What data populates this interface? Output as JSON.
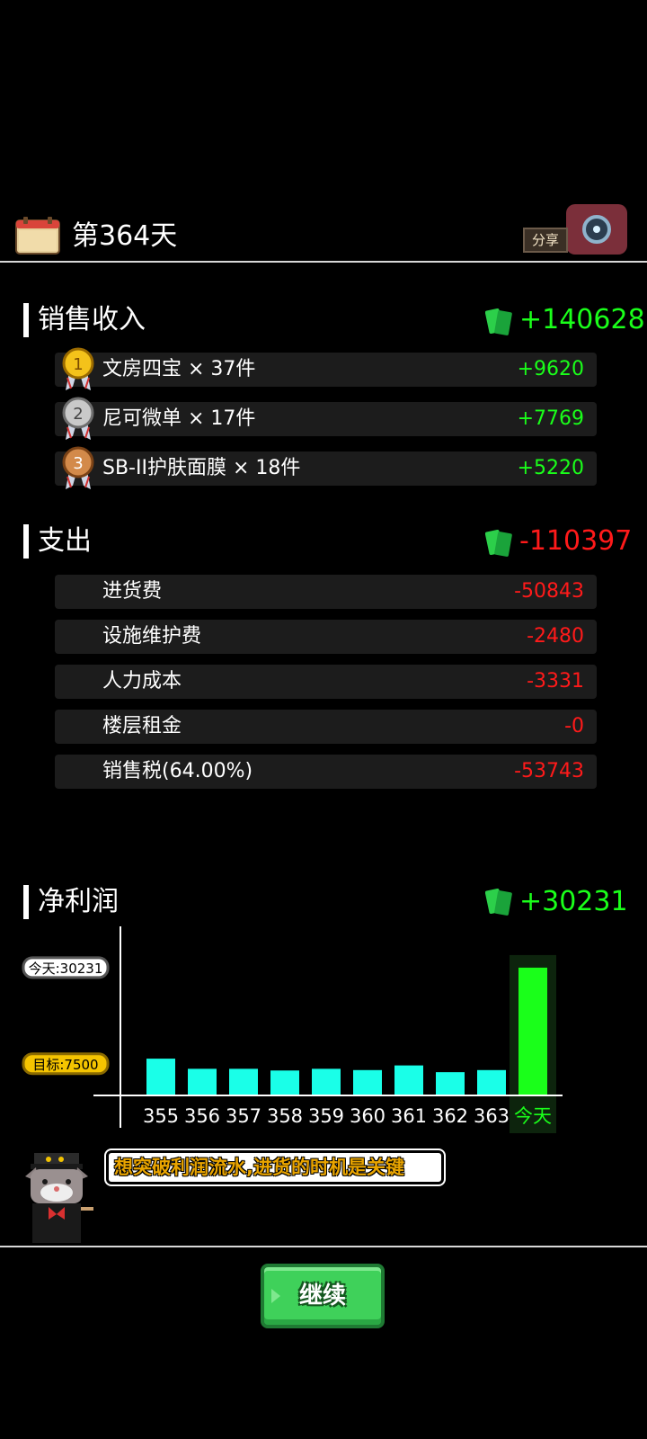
{
  "header": {
    "day_title": "第364天",
    "share_label": "分享"
  },
  "income": {
    "title": "销售收入",
    "total": "+140628",
    "items": [
      {
        "rank": "1",
        "name": "文房四宝 × 37件",
        "amount": "+9620"
      },
      {
        "rank": "2",
        "name": "尼可微单 × 17件",
        "amount": "+7769"
      },
      {
        "rank": "3",
        "name": "SB-II护肤面膜 × 18件",
        "amount": "+5220"
      }
    ]
  },
  "expense": {
    "title": "支出",
    "total": "-110397",
    "items": [
      {
        "name": "进货费",
        "amount": "-50843"
      },
      {
        "name": "设施维护费",
        "amount": "-2480"
      },
      {
        "name": "人力成本",
        "amount": "-3331"
      },
      {
        "name": "楼层租金",
        "amount": "-0"
      },
      {
        "name": "销售税(64.00%)",
        "amount": "-53743"
      }
    ]
  },
  "profit": {
    "title": "净利润",
    "total": "+30231"
  },
  "chart_data": {
    "type": "bar",
    "categories": [
      "355",
      "356",
      "357",
      "358",
      "359",
      "360",
      "361",
      "362",
      "363",
      "今天"
    ],
    "values": [
      8700,
      6300,
      6300,
      5900,
      6300,
      6000,
      7100,
      5500,
      6000,
      30231
    ],
    "today_label": "今天:30231",
    "target_label": "目标:7500",
    "target_value": 7500,
    "ylim": [
      0,
      40000
    ],
    "colors": {
      "history": "#1affe8",
      "today": "#1aff1a",
      "today_bg": "#0d240d",
      "badge_today": "#ffffff",
      "badge_target": "#f5c400"
    }
  },
  "tip": {
    "text": "想突破利润流水,进货的时机是关键"
  },
  "continue_button": {
    "label": "继续"
  },
  "colors": {
    "positive": "#1aff1a",
    "negative": "#ff1a1a",
    "row_bg": "#1c1c1c"
  }
}
